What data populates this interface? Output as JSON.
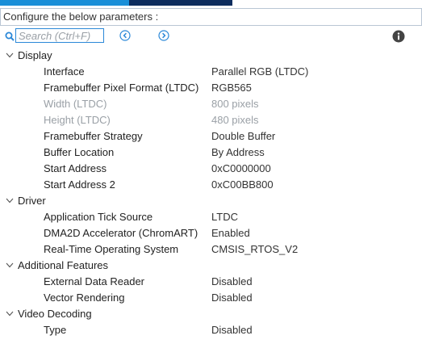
{
  "window": {
    "top_bar_colors": [
      "#1a8fd8",
      "#0d2d5e"
    ]
  },
  "header": {
    "label": "Configure the below parameters :"
  },
  "search": {
    "placeholder": "Search (Ctrl+F)",
    "value": ""
  },
  "icons": {
    "search": "search-icon",
    "prev": "circle-left-icon",
    "next": "circle-right-icon",
    "info": "info-icon",
    "expand": "chevron-down-icon"
  },
  "categories": [
    {
      "label": "Display",
      "expanded": true,
      "params": [
        {
          "name": "Interface",
          "value": "Parallel RGB (LTDC)",
          "enabled": true
        },
        {
          "name": "Framebuffer Pixel Format (LTDC)",
          "value": "RGB565",
          "enabled": true
        },
        {
          "name": "Width (LTDC)",
          "value": "800 pixels",
          "enabled": false
        },
        {
          "name": "Height (LTDC)",
          "value": "480 pixels",
          "enabled": false
        },
        {
          "name": "Framebuffer Strategy",
          "value": "Double Buffer",
          "enabled": true
        },
        {
          "name": "Buffer Location",
          "value": "By Address",
          "enabled": true
        },
        {
          "name": "Start Address",
          "value": "0xC0000000",
          "enabled": true
        },
        {
          "name": "Start Address 2",
          "value": "0xC00BB800",
          "enabled": true
        }
      ]
    },
    {
      "label": "Driver",
      "expanded": true,
      "params": [
        {
          "name": "Application Tick Source",
          "value": "LTDC",
          "enabled": true
        },
        {
          "name": "DMA2D Accelerator (ChromART)",
          "value": "Enabled",
          "enabled": true
        },
        {
          "name": "Real-Time Operating System",
          "value": "CMSIS_RTOS_V2",
          "enabled": true
        }
      ]
    },
    {
      "label": "Additional Features",
      "expanded": true,
      "params": [
        {
          "name": "External Data Reader",
          "value": "Disabled",
          "enabled": true
        },
        {
          "name": "Vector Rendering",
          "value": "Disabled",
          "enabled": true
        }
      ]
    },
    {
      "label": "Video Decoding",
      "expanded": true,
      "params": [
        {
          "name": "Type",
          "value": "Disabled",
          "enabled": true
        }
      ]
    }
  ]
}
